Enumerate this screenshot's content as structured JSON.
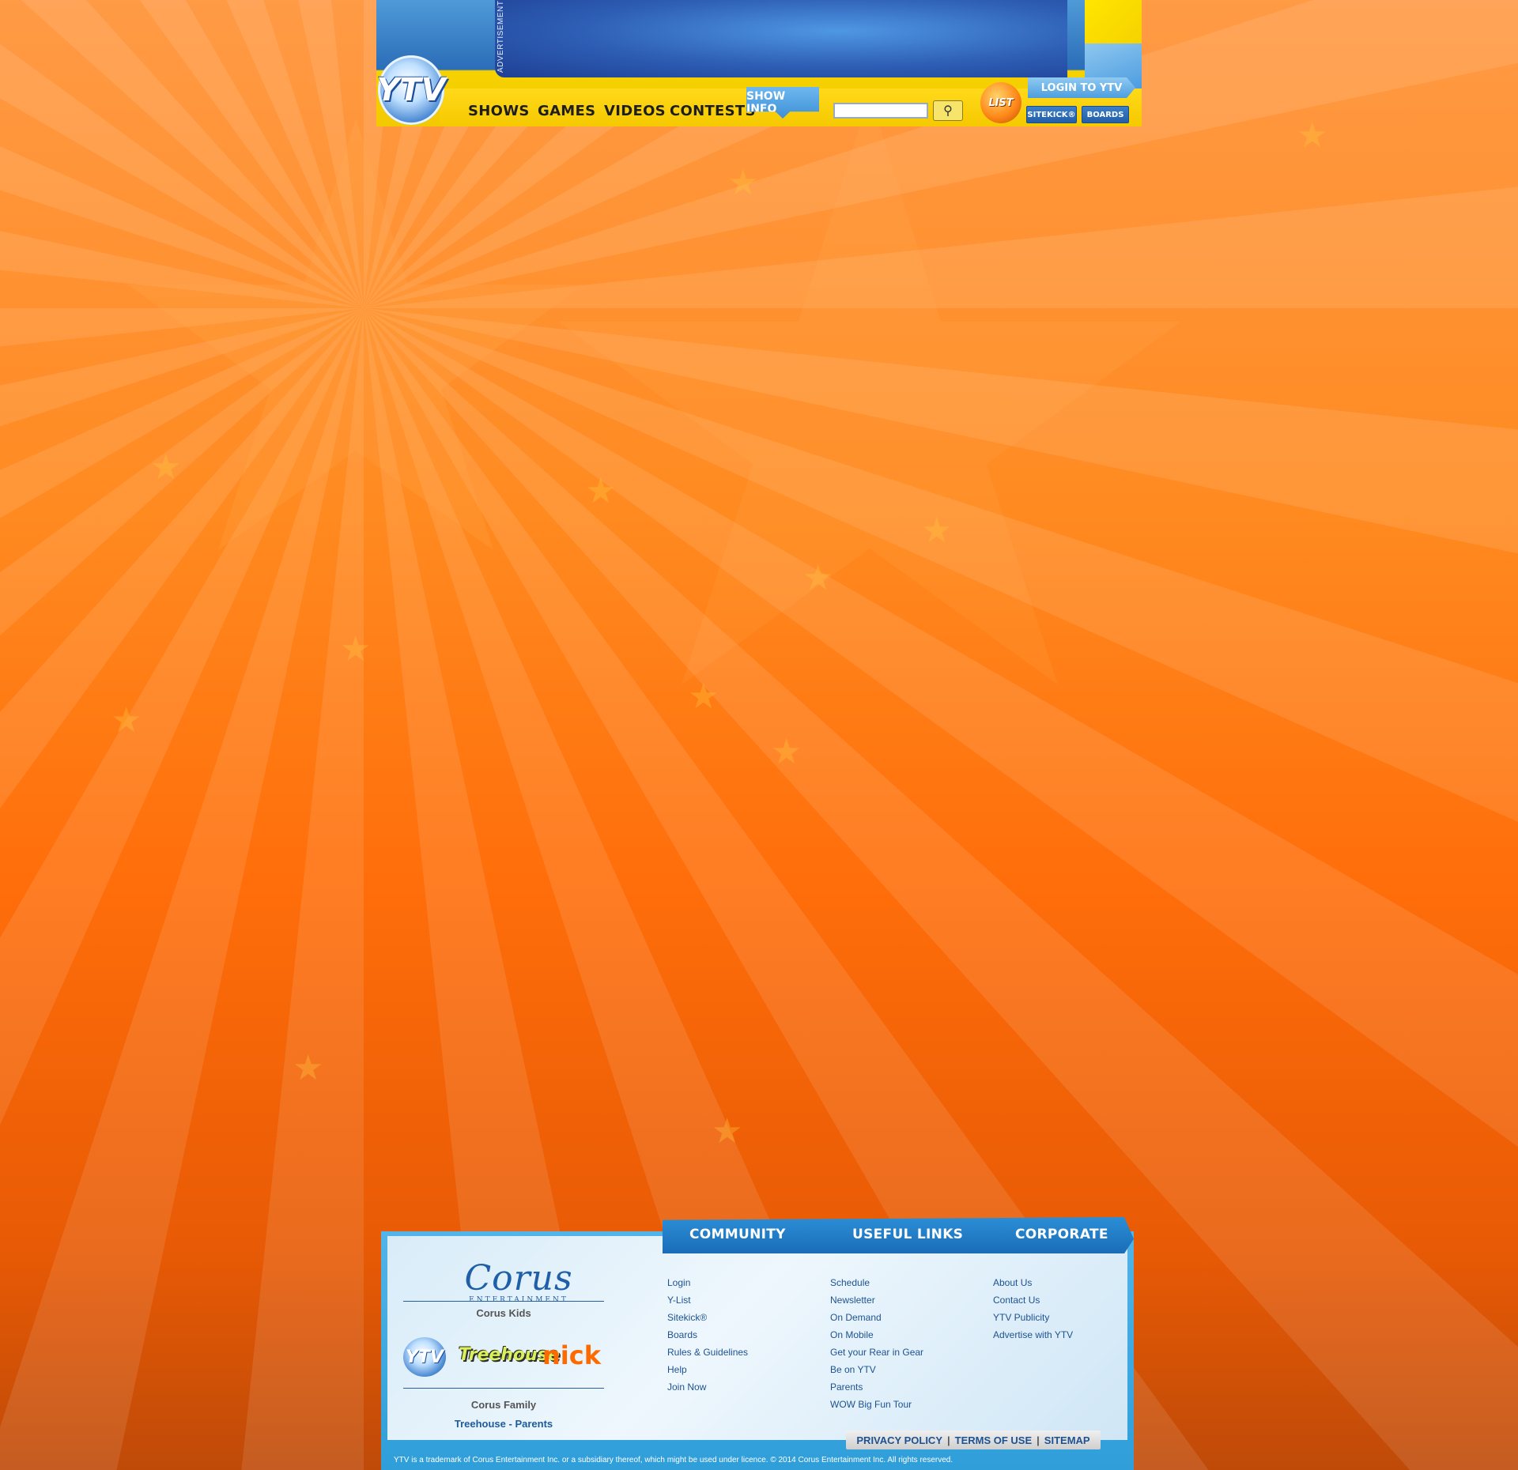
{
  "header": {
    "ad_label": "ADVERTISEMENT",
    "logo_text": "YTV",
    "nav": [
      "SHOWS",
      "GAMES",
      "VIDEOS",
      "CONTESTS"
    ],
    "show_info": "SHOW INFO",
    "search_placeholder": "",
    "ylist_label": "LIST",
    "login_label": "LOGIN TO YTV",
    "sitekick_label": "SITEKICK®",
    "boards_label": "BOARDS"
  },
  "footer": {
    "tabs": [
      "COMMUNITY",
      "USEFUL LINKS",
      "CORPORATE"
    ],
    "corus_word": "Corus",
    "corus_sub": "ENTERTAINMENT",
    "corus_kids": "Corus Kids",
    "brands": [
      "YTV",
      "Treehouse",
      "nick"
    ],
    "corus_family": "Corus Family",
    "treehouse_parents": "Treehouse - Parents",
    "community_links": [
      "Login",
      "Y-List",
      "Sitekick®",
      "Boards",
      "Rules & Guidelines",
      "Help",
      "Join Now"
    ],
    "useful_links": [
      "Schedule",
      "Newsletter",
      "On Demand",
      "On Mobile",
      "Get your Rear in Gear",
      "Be on YTV",
      "Parents",
      "WOW Big Fun Tour"
    ],
    "corporate_links": [
      "About Us",
      "Contact Us",
      "YTV Publicity",
      "Advertise with YTV"
    ],
    "legal": [
      "PRIVACY POLICY",
      "TERMS OF USE",
      "SITEMAP"
    ],
    "copyright": "YTV is a trademark of Corus Entertainment Inc. or a subsidiary thereof, which might be used under licence. © 2014 Corus Entertainment Inc. All rights reserved."
  }
}
